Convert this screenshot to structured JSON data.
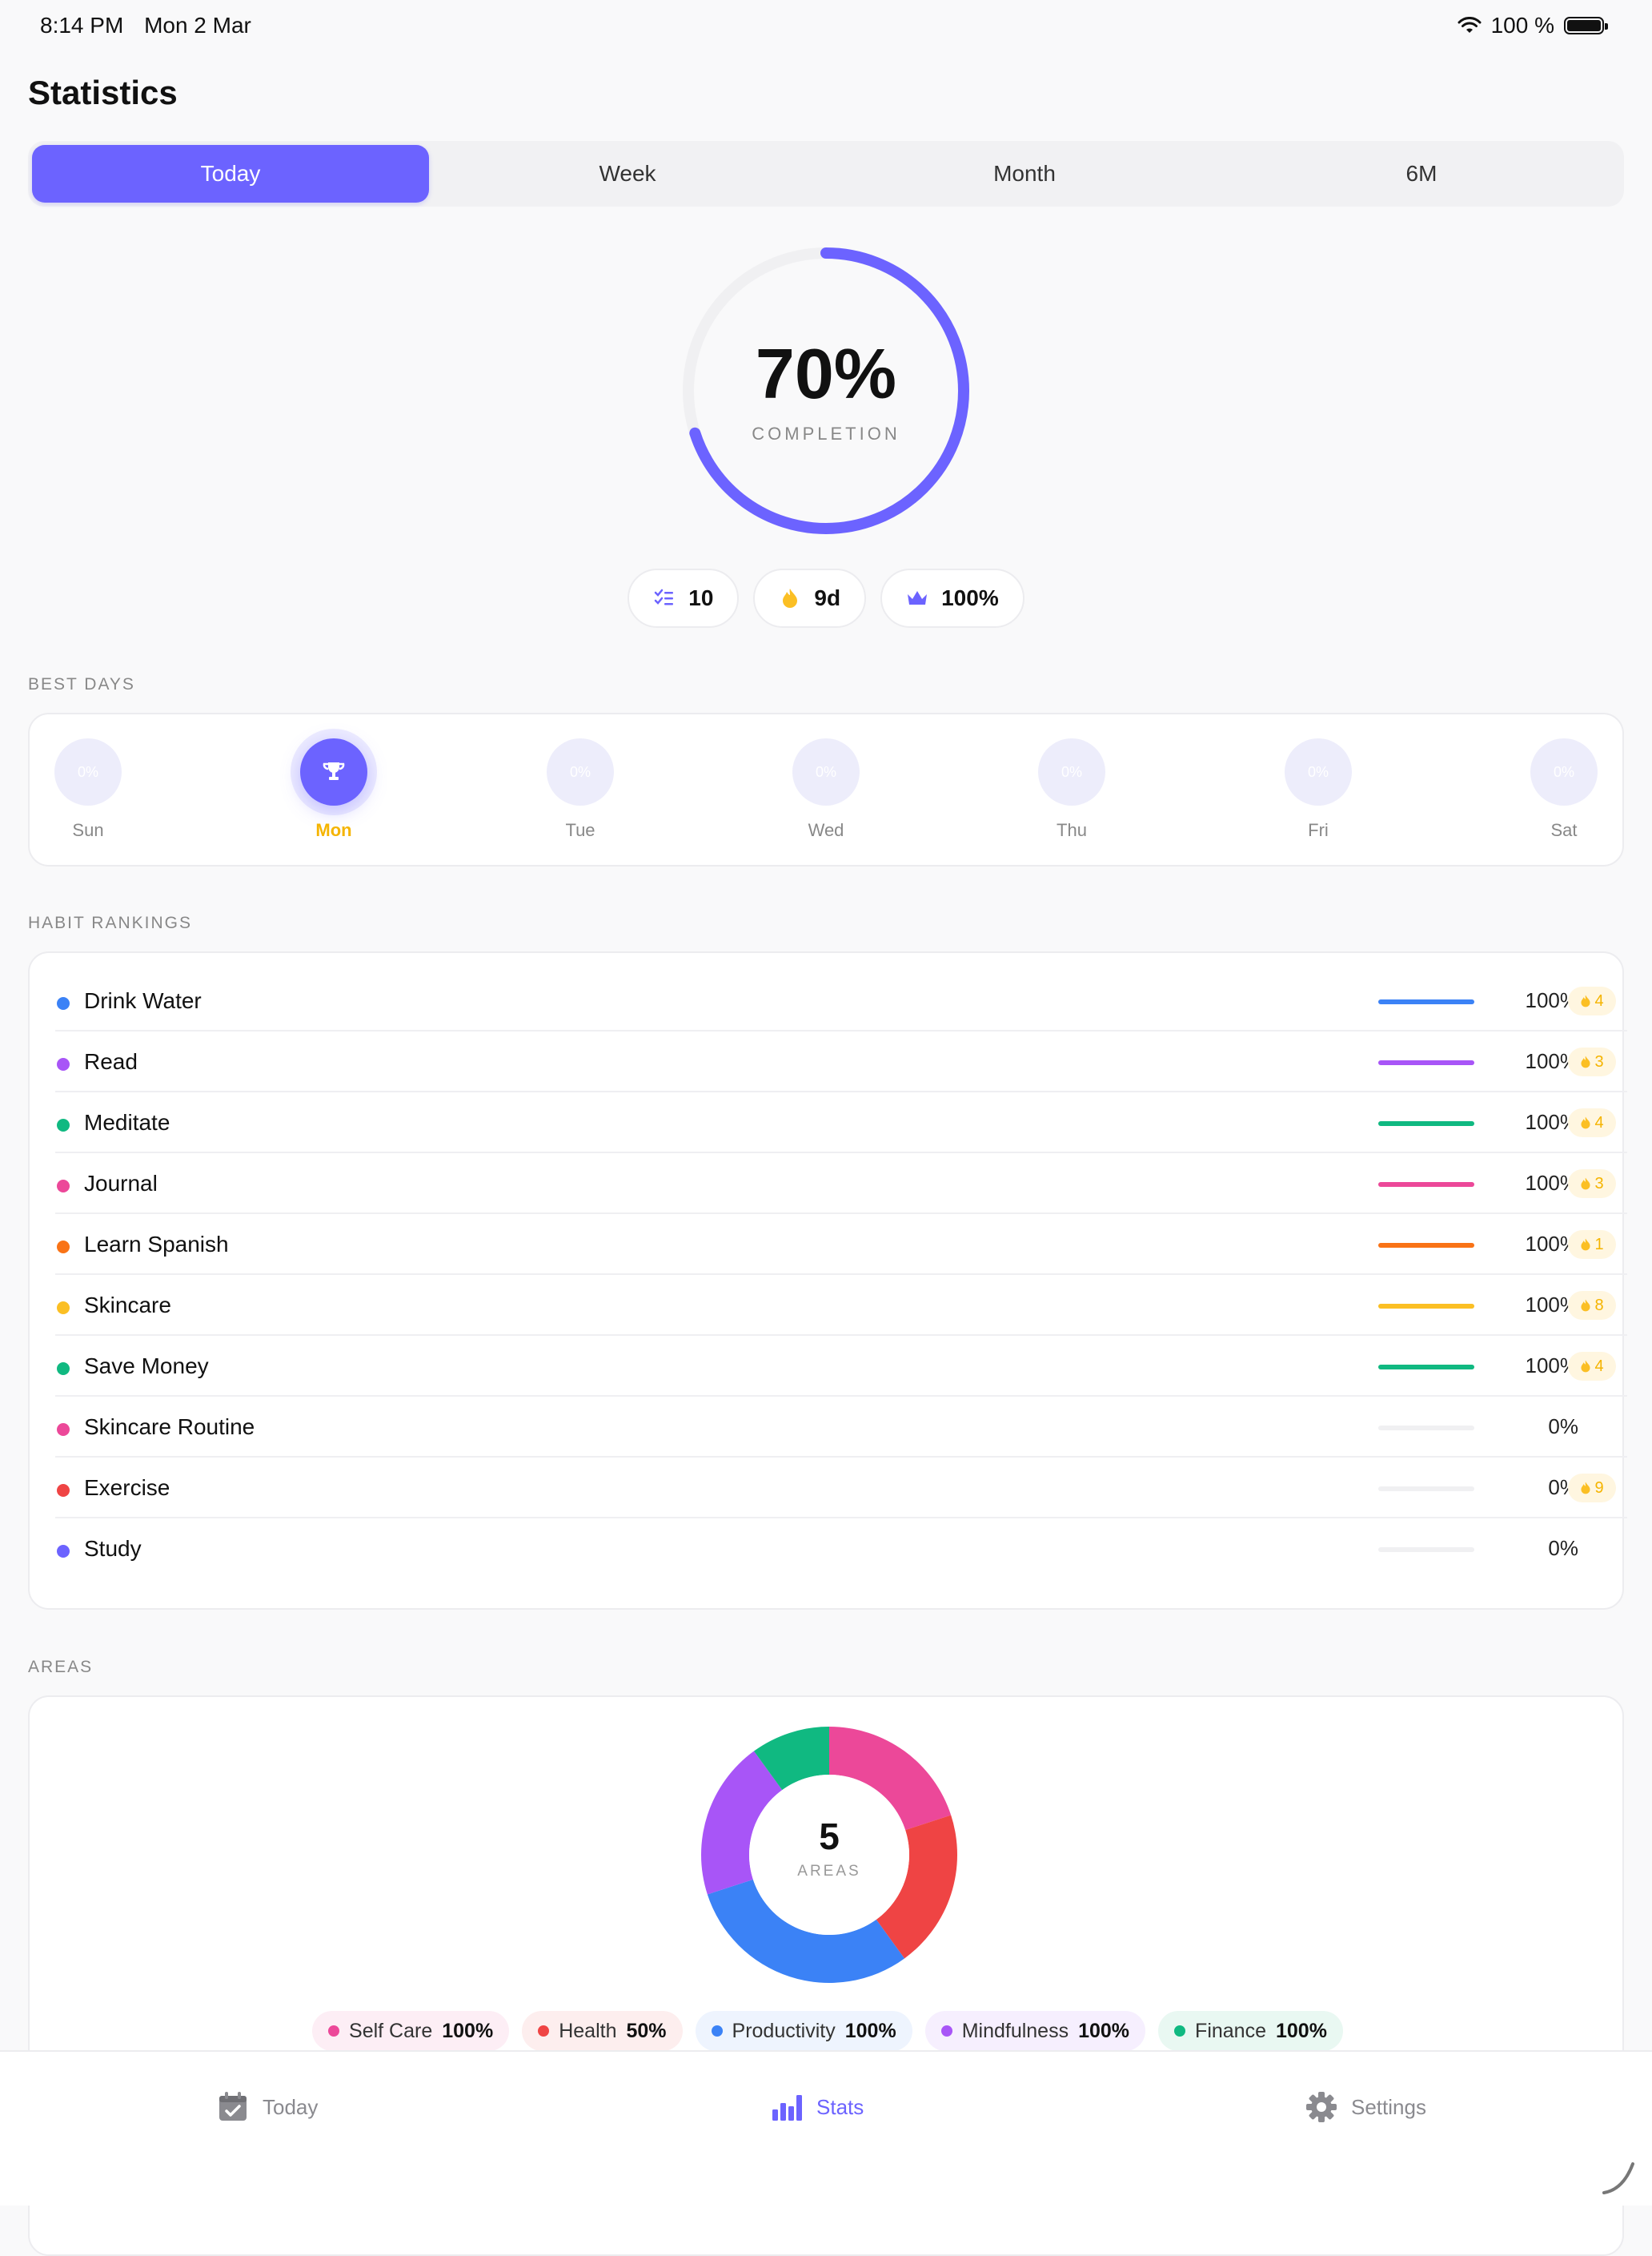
{
  "status": {
    "time": "8:14 PM",
    "date": "Mon 2 Mar",
    "battery": "100 %"
  },
  "page": {
    "title": "Statistics"
  },
  "segments": [
    {
      "label": "Today",
      "active": true
    },
    {
      "label": "Week",
      "active": false
    },
    {
      "label": "Month",
      "active": false
    },
    {
      "label": "6M",
      "active": false
    }
  ],
  "completion": {
    "value": "70%",
    "label": "COMPLETION",
    "fraction": 0.7,
    "color": "#6c63ff"
  },
  "pills": [
    {
      "icon": "checklist-icon",
      "text": "10"
    },
    {
      "icon": "flame-icon",
      "text": "9d"
    },
    {
      "icon": "crown-icon",
      "text": "100%"
    }
  ],
  "best_days": {
    "title": "BEST DAYS",
    "days": [
      {
        "name": "Sun",
        "value": "0%",
        "best": false
      },
      {
        "name": "Mon",
        "value": "",
        "best": true,
        "icon": "trophy-icon"
      },
      {
        "name": "Tue",
        "value": "0%",
        "best": false
      },
      {
        "name": "Wed",
        "value": "0%",
        "best": false
      },
      {
        "name": "Thu",
        "value": "0%",
        "best": false
      },
      {
        "name": "Fri",
        "value": "0%",
        "best": false
      },
      {
        "name": "Sat",
        "value": "0%",
        "best": false
      }
    ]
  },
  "rankings": {
    "title": "HABIT RANKINGS",
    "habits": [
      {
        "name": "Drink Water",
        "pct": "100%",
        "progress": 1.0,
        "color": "#3b82f6",
        "streak": "4"
      },
      {
        "name": "Read",
        "pct": "100%",
        "progress": 1.0,
        "color": "#a855f7",
        "streak": "3"
      },
      {
        "name": "Meditate",
        "pct": "100%",
        "progress": 1.0,
        "color": "#10b981",
        "streak": "4"
      },
      {
        "name": "Journal",
        "pct": "100%",
        "progress": 1.0,
        "color": "#ec4899",
        "streak": "3"
      },
      {
        "name": "Learn Spanish",
        "pct": "100%",
        "progress": 1.0,
        "color": "#f97316",
        "streak": "1"
      },
      {
        "name": "Skincare",
        "pct": "100%",
        "progress": 1.0,
        "color": "#fbbf24",
        "streak": "8"
      },
      {
        "name": "Save Money",
        "pct": "100%",
        "progress": 1.0,
        "color": "#10b981",
        "streak": "4"
      },
      {
        "name": "Skincare Routine",
        "pct": "0%",
        "progress": 0,
        "color": "#ec4899",
        "streak": ""
      },
      {
        "name": "Exercise",
        "pct": "0%",
        "progress": 0,
        "color": "#ef4444",
        "streak": "9"
      },
      {
        "name": "Study",
        "pct": "0%",
        "progress": 0,
        "color": "#6c63ff",
        "streak": ""
      }
    ]
  },
  "areas": {
    "title": "AREAS",
    "count": "5",
    "count_label": "AREAS",
    "items": [
      {
        "name": "Self Care",
        "value": "100%",
        "color": "#ec4899",
        "bg": "#fdeef5",
        "share": 2
      },
      {
        "name": "Health",
        "value": "50%",
        "color": "#ef4444",
        "bg": "#fdeeee",
        "share": 2
      },
      {
        "name": "Productivity",
        "value": "100%",
        "color": "#3b82f6",
        "bg": "#eef4fe",
        "share": 3
      },
      {
        "name": "Mindfulness",
        "value": "100%",
        "color": "#a855f7",
        "bg": "#f6effe",
        "share": 2
      },
      {
        "name": "Finance",
        "value": "100%",
        "color": "#10b981",
        "bg": "#e9f8f2",
        "share": 1
      }
    ]
  },
  "tabbar": [
    {
      "label": "Today",
      "icon": "calendar-check-icon",
      "active": false
    },
    {
      "label": "Stats",
      "icon": "bar-chart-icon",
      "active": true
    },
    {
      "label": "Settings",
      "icon": "gear-icon",
      "active": false
    }
  ]
}
